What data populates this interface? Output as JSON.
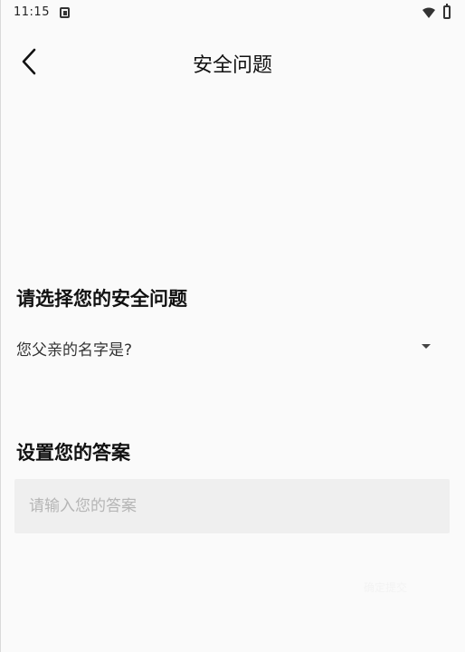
{
  "status_bar": {
    "time": "11:15",
    "icons": [
      "notification-icon",
      "wifi-icon",
      "battery-icon"
    ]
  },
  "header": {
    "title": "安全问题",
    "back_icon": "chevron-left-icon"
  },
  "question_section": {
    "title": "请选择您的安全问题",
    "selected_question": "您父亲的名字是?",
    "dropdown_icon": "caret-down-icon"
  },
  "answer_section": {
    "title": "设置您的答案",
    "value": "",
    "placeholder": "请输入您的答案"
  },
  "actions": {
    "submit_label": "确定提交"
  },
  "colors": {
    "background": "#fafafa",
    "input_background": "#efefef",
    "placeholder": "#b5b5b5",
    "text": "#111111"
  }
}
